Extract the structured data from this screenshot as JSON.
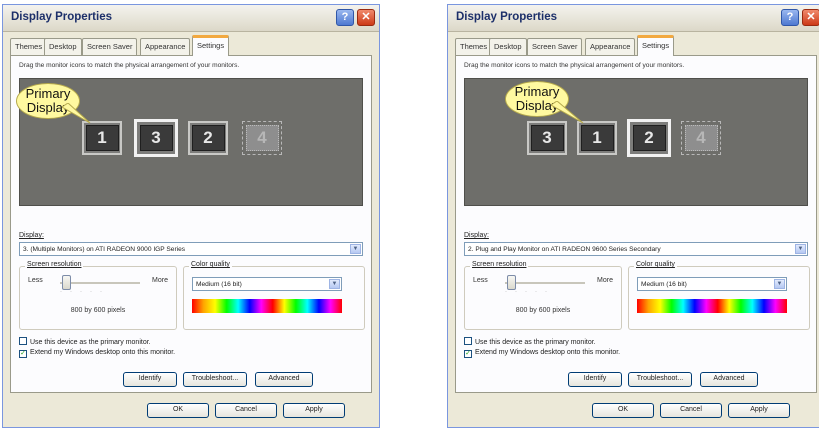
{
  "windows": [
    {
      "title": "Display Properties",
      "tabs": [
        "Themes",
        "Desktop",
        "Screen Saver",
        "Appearance",
        "Settings"
      ],
      "active_tab": "Settings",
      "instruction": "Drag the monitor icons to match the physical arrangement of your monitors.",
      "callout": [
        "Primary",
        "Display"
      ],
      "monitors": [
        "1",
        "3",
        "2",
        "4"
      ],
      "display_label": "Display:",
      "display_value": "3. (Multiple Monitors) on ATI RADEON 9000 IGP Series",
      "resolution": {
        "label": "Screen resolution",
        "less": "Less",
        "more": "More",
        "value": "800 by 600 pixels",
        "level": 0.1
      },
      "color": {
        "label": "Color quality",
        "value": "Medium (16 bit)"
      },
      "checks": [
        {
          "label": "Use this device as the primary monitor.",
          "checked": false
        },
        {
          "label": "Extend my Windows desktop onto this monitor.",
          "checked": true
        }
      ],
      "buttons": [
        "Identify",
        "Troubleshoot...",
        "Advanced"
      ],
      "dialog_buttons": [
        "OK",
        "Cancel",
        "Apply"
      ]
    },
    {
      "title": "Display Properties",
      "tabs": [
        "Themes",
        "Desktop",
        "Screen Saver",
        "Appearance",
        "Settings"
      ],
      "active_tab": "Settings",
      "instruction": "Drag the monitor icons to match the physical arrangement of your monitors.",
      "callout": [
        "Primary",
        "Display"
      ],
      "monitors": [
        "3",
        "1",
        "2",
        "4"
      ],
      "display_label": "Display:",
      "display_value": "2. Plug and Play Monitor on ATI RADEON 9600 Series Secondary",
      "resolution": {
        "label": "Screen resolution",
        "less": "Less",
        "more": "More",
        "value": "800 by 600 pixels",
        "level": 0.1
      },
      "color": {
        "label": "Color quality",
        "value": "Medium (16 bit)"
      },
      "checks": [
        {
          "label": "Use this device as the primary monitor.",
          "checked": false
        },
        {
          "label": "Extend my Windows desktop onto this monitor.",
          "checked": true
        }
      ],
      "buttons": [
        "Identify",
        "Troubleshoot...",
        "Advanced"
      ],
      "dialog_buttons": [
        "OK",
        "Cancel",
        "Apply"
      ]
    }
  ],
  "icons": {
    "help": "help-icon",
    "close": "close-icon",
    "dropdown": "chevron-down-icon",
    "check": "checkmark-icon"
  },
  "colors": {
    "callout": "#fff9a0",
    "monitor_area": "#6e6e6a",
    "active_tab_accent": "#f2a940"
  }
}
